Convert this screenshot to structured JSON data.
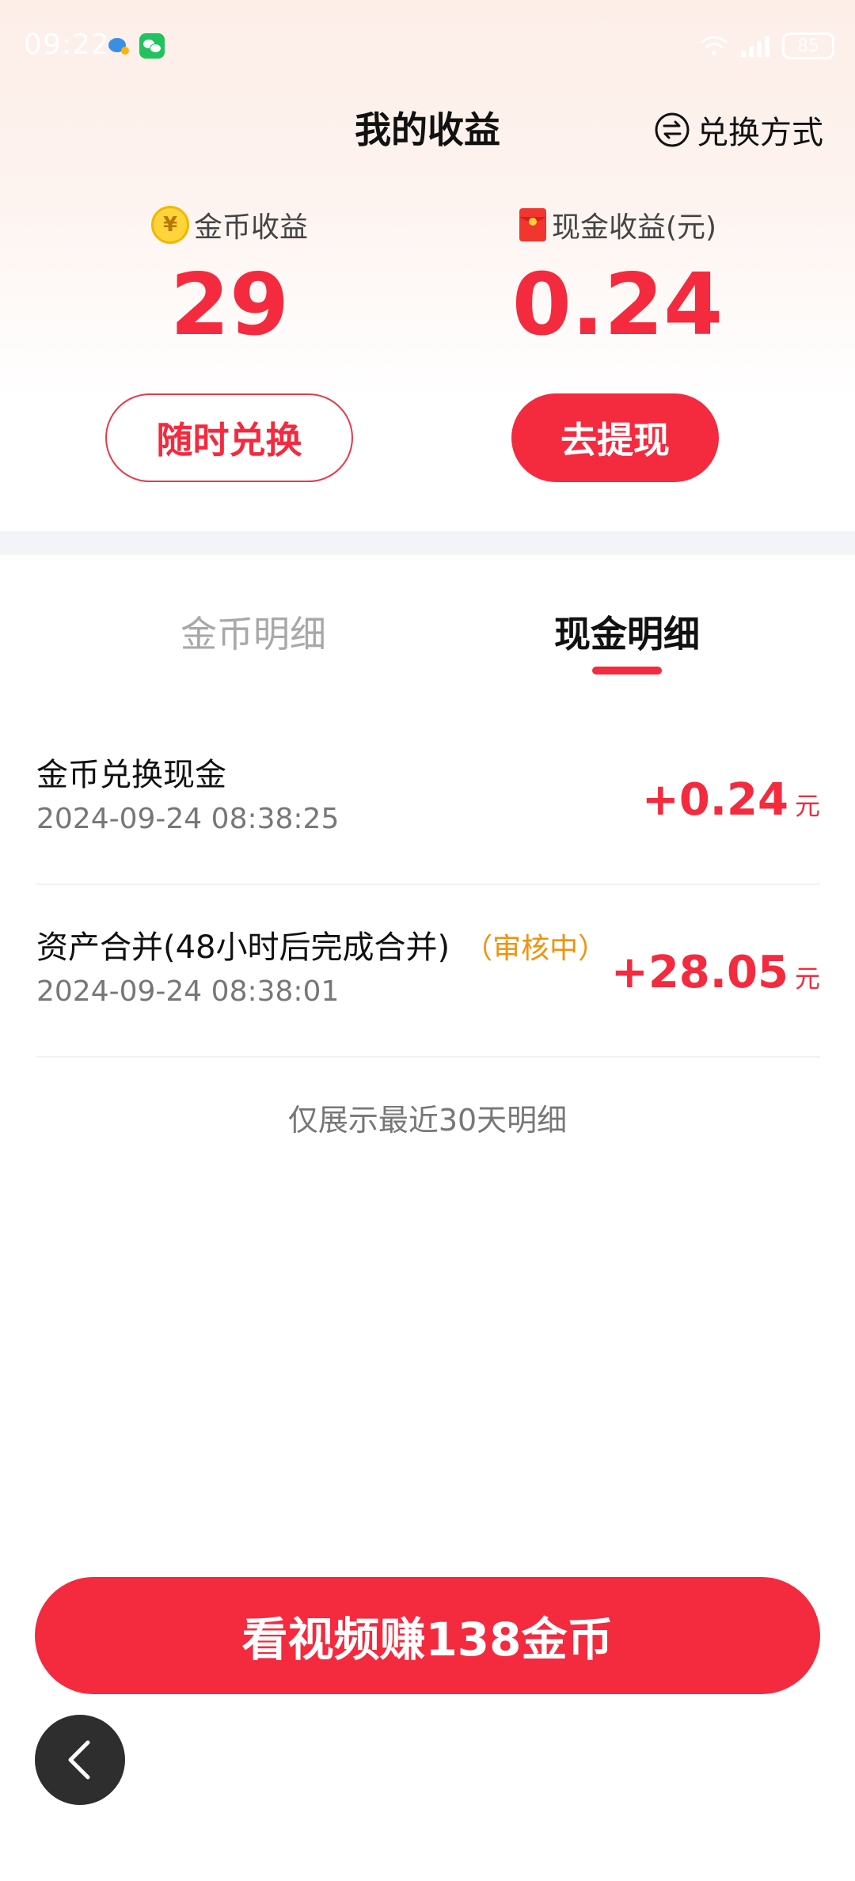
{
  "status_bar": {
    "time": "09:22",
    "battery": "85"
  },
  "header": {
    "title": "我的收益",
    "exchange_label": "兑换方式"
  },
  "summary": {
    "coin_label": "金币收益",
    "coin_value": "29",
    "cash_label": "现金收益(元)",
    "cash_value": "0.24",
    "exchange_button": "随时兑换",
    "withdraw_button": "去提现"
  },
  "tabs": [
    {
      "label": "金币明细",
      "active": false
    },
    {
      "label": "现金明细",
      "active": true
    }
  ],
  "records": [
    {
      "title": "金币兑换现金",
      "status": "",
      "time": "2024-09-24 08:38:25",
      "amount": "+0.24",
      "unit": "元"
    },
    {
      "title": "资产合并(48小时后完成合并)",
      "status": "（审核中）",
      "time": "2024-09-24 08:38:01",
      "amount": "+28.05",
      "unit": "元"
    }
  ],
  "note": "仅展示最近30天明细",
  "cta_label": "看视频赚138金币",
  "colors": {
    "accent": "#f42a3e",
    "pending": "#f0920c",
    "back_fab": "#2e2e2e"
  }
}
